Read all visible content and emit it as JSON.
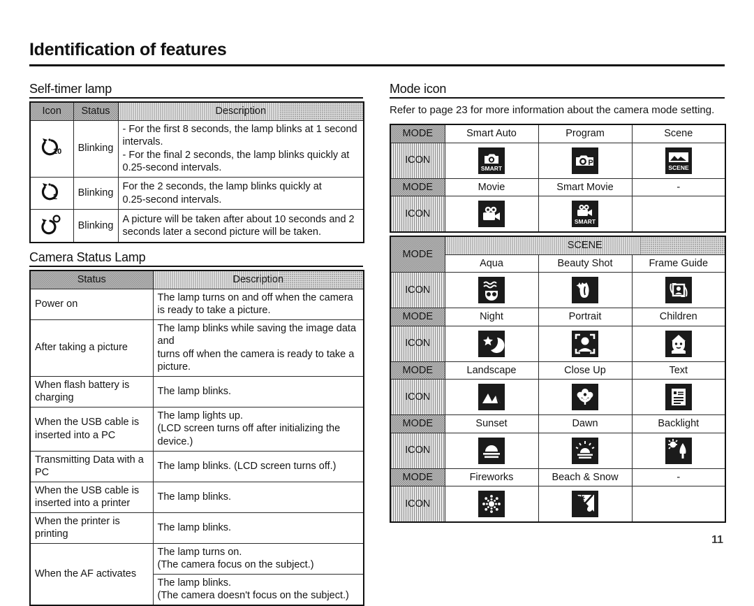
{
  "page": {
    "title": "Identification of features",
    "folio": "11"
  },
  "self_timer": {
    "heading": "Self-timer lamp",
    "columns": [
      "Icon",
      "Status",
      "Description"
    ],
    "rows": [
      {
        "icon": "self-timer-10sec-icon",
        "status": "Blinking",
        "description": "- For the first 8 seconds, the lamp blinks at 1 second\n   intervals.\n- For the final 2 seconds, the lamp blinks quickly at\n   0.25-second intervals."
      },
      {
        "icon": "self-timer-2sec-icon",
        "status": "Blinking",
        "description": "For the 2 seconds, the lamp blinks quickly at\n0.25-second intervals."
      },
      {
        "icon": "self-timer-double-icon",
        "status": "Blinking",
        "description": "A picture will be taken after about 10 seconds and 2\nseconds later a second picture will be taken."
      }
    ]
  },
  "camera_status": {
    "heading": "Camera Status Lamp",
    "columns": [
      "Status",
      "Description"
    ],
    "rows": [
      {
        "status": "Power on",
        "description": "The lamp turns on and off when the camera\nis ready to take a picture."
      },
      {
        "status": "After taking a picture",
        "description": "The lamp blinks while saving the image data and\nturns off when the camera is ready to take a picture."
      },
      {
        "status": "When flash battery is charging",
        "description": "The lamp blinks."
      },
      {
        "status": "When the USB cable is\ninserted into a PC",
        "description": "The lamp lights up.\n(LCD screen turns off after initializing the device.)"
      },
      {
        "status": "Transmitting Data with a PC",
        "description": "The lamp blinks. (LCD screen turns off.)"
      },
      {
        "status": "When the USB cable is\ninserted into a printer",
        "description": "The lamp blinks."
      },
      {
        "status": "When the printer is printing",
        "description": "The lamp blinks."
      },
      {
        "status": "When the AF activates",
        "description": "The lamp turns on.\n(The camera focus on the subject.)",
        "description2": "The lamp blinks.\n(The camera doesn't focus on the subject.)"
      }
    ]
  },
  "mode_icon": {
    "heading": "Mode icon",
    "note": "Refer to page 23 for more information about the camera mode setting.",
    "label_mode": "MODE",
    "label_icon": "ICON",
    "scene_banner": "SCENE",
    "empty_mark": "-",
    "groups": [
      {
        "modes": [
          "Smart Auto",
          "Program",
          "Scene"
        ],
        "icons": [
          "smart-auto-icon",
          "program-icon",
          "scene-icon"
        ]
      },
      {
        "modes": [
          "Movie",
          "Smart Movie",
          "-"
        ],
        "icons": [
          "movie-icon",
          "smart-movie-icon",
          ""
        ]
      }
    ],
    "scene_groups": [
      {
        "modes": [
          "Aqua",
          "Beauty Shot",
          "Frame Guide"
        ],
        "icons": [
          "aqua-icon",
          "beauty-shot-icon",
          "frame-guide-icon"
        ]
      },
      {
        "modes": [
          "Night",
          "Portrait",
          "Children"
        ],
        "icons": [
          "night-icon",
          "portrait-icon",
          "children-icon"
        ]
      },
      {
        "modes": [
          "Landscape",
          "Close Up",
          "Text"
        ],
        "icons": [
          "landscape-icon",
          "close-up-icon",
          "text-icon"
        ]
      },
      {
        "modes": [
          "Sunset",
          "Dawn",
          "Backlight"
        ],
        "icons": [
          "sunset-icon",
          "dawn-icon",
          "backlight-icon"
        ]
      },
      {
        "modes": [
          "Fireworks",
          "Beach & Snow",
          "-"
        ],
        "icons": [
          "fireworks-icon",
          "beach-snow-icon",
          ""
        ]
      }
    ]
  }
}
